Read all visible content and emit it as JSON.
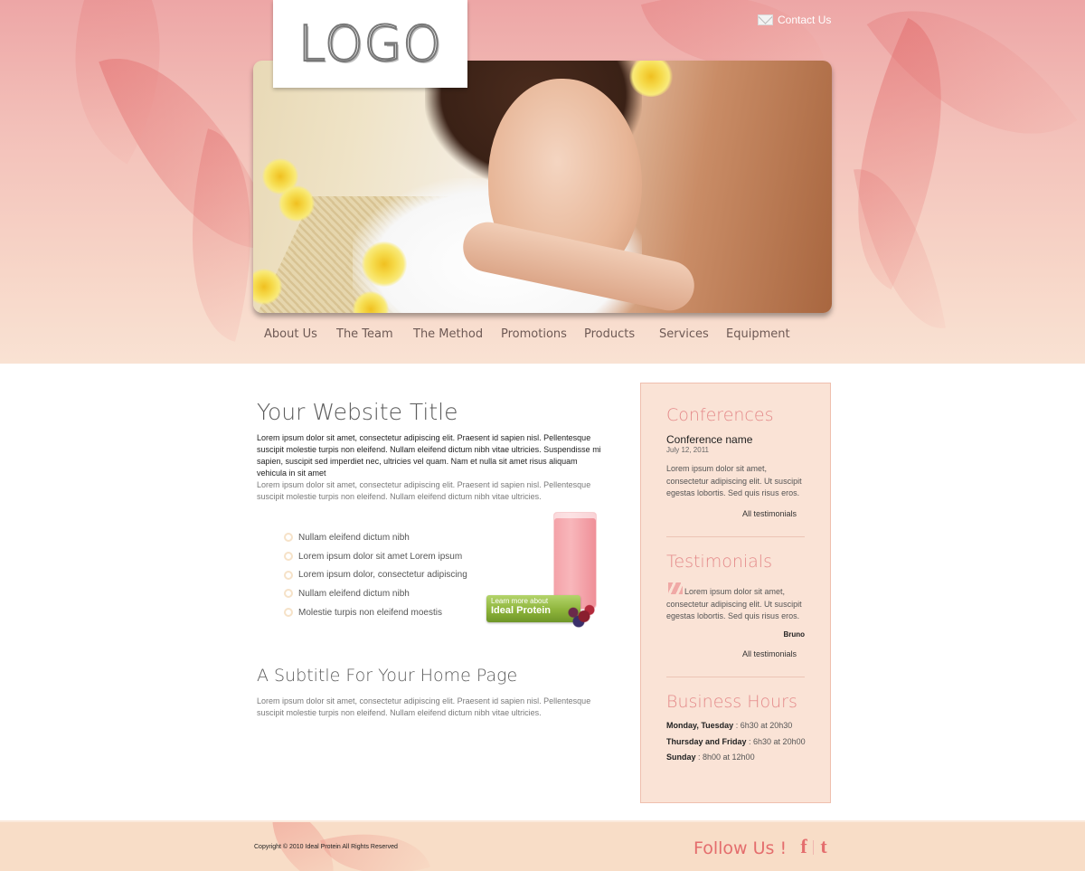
{
  "header": {
    "logo": "LOGO",
    "contact_label": "Contact Us",
    "nav": [
      {
        "label": "About Us"
      },
      {
        "label": "The Team"
      },
      {
        "label": "The Method"
      },
      {
        "label": "Promotions"
      },
      {
        "label": "Products"
      },
      {
        "label": "Services"
      },
      {
        "label": "Equipment"
      }
    ]
  },
  "main": {
    "title": "Your Website Title",
    "intro": "Lorem ipsum dolor sit amet, consectetur adipiscing elit. Praesent id sapien nisl. Pellentesque suscipit molestie turpis non eleifend. Nullam eleifend dictum nibh vitae ultricies. Suspendisse mi sapien, suscipit sed imperdiet nec, ultricies vel quam. Nam et nulla sit amet risus aliquam vehicula in sit amet",
    "paragraph": "Lorem ipsum dolor sit amet, consectetur adipiscing elit. Praesent id sapien nisl. Pellentesque suscipit molestie turpis non eleifend. Nullam eleifend dictum nibh vitae ultricies.",
    "bullets": [
      "Nullam eleifend dictum nibh",
      "Lorem ipsum dolor sit amet Lorem ipsum",
      "Lorem ipsum dolor, consectetur adipiscing",
      "Nullam eleifend dictum nibh",
      "Molestie turpis non eleifend moestis"
    ],
    "promo": {
      "small": "Learn more about",
      "big": "Ideal Protein"
    },
    "subtitle": "A Subtitle For Your Home Page",
    "paragraph2": "Lorem ipsum dolor sit amet, consectetur adipiscing elit. Praesent id sapien nisl. Pellentesque suscipit molestie turpis non eleifend. Nullam eleifend dictum nibh vitae ultricies."
  },
  "sidebar": {
    "conferences": {
      "heading": "Conferences",
      "name": "Conference name",
      "date": "July 12, 2011",
      "text": "Lorem ipsum dolor sit amet, consectetur adipiscing elit. Ut suscipit egestas lobortis. Sed quis risus eros.",
      "link": "All testimonials"
    },
    "testimonials": {
      "heading": "Testimonials",
      "text": "Lorem ipsum dolor sit amet, consectetur adipiscing elit. Ut suscipit egestas lobortis. Sed quis risus eros.",
      "author": "Bruno",
      "link": "All testimonials"
    },
    "hours": {
      "heading": "Business Hours",
      "rows": [
        {
          "days": "Monday, Tuesday",
          "time": " : 6h30 at 20h30"
        },
        {
          "days": "Thursday and Friday",
          "time": " : 6h30 at 20h00"
        },
        {
          "days": "Sunday",
          "time": " : 8h00 at 12h00"
        }
      ]
    }
  },
  "footer": {
    "copyright": "Copyright © 2010 Ideal Protein All Rights Reserved",
    "follow": "Follow Us !",
    "facebook_glyph": "f",
    "twitter_glyph": "t"
  },
  "colors": {
    "accent": "#e46d6d",
    "header_pink": "#eda6a6",
    "sidebar_bg": "#fae3d6",
    "footer_bg": "#f8ddc7",
    "promo_green": "#8eb43b"
  }
}
